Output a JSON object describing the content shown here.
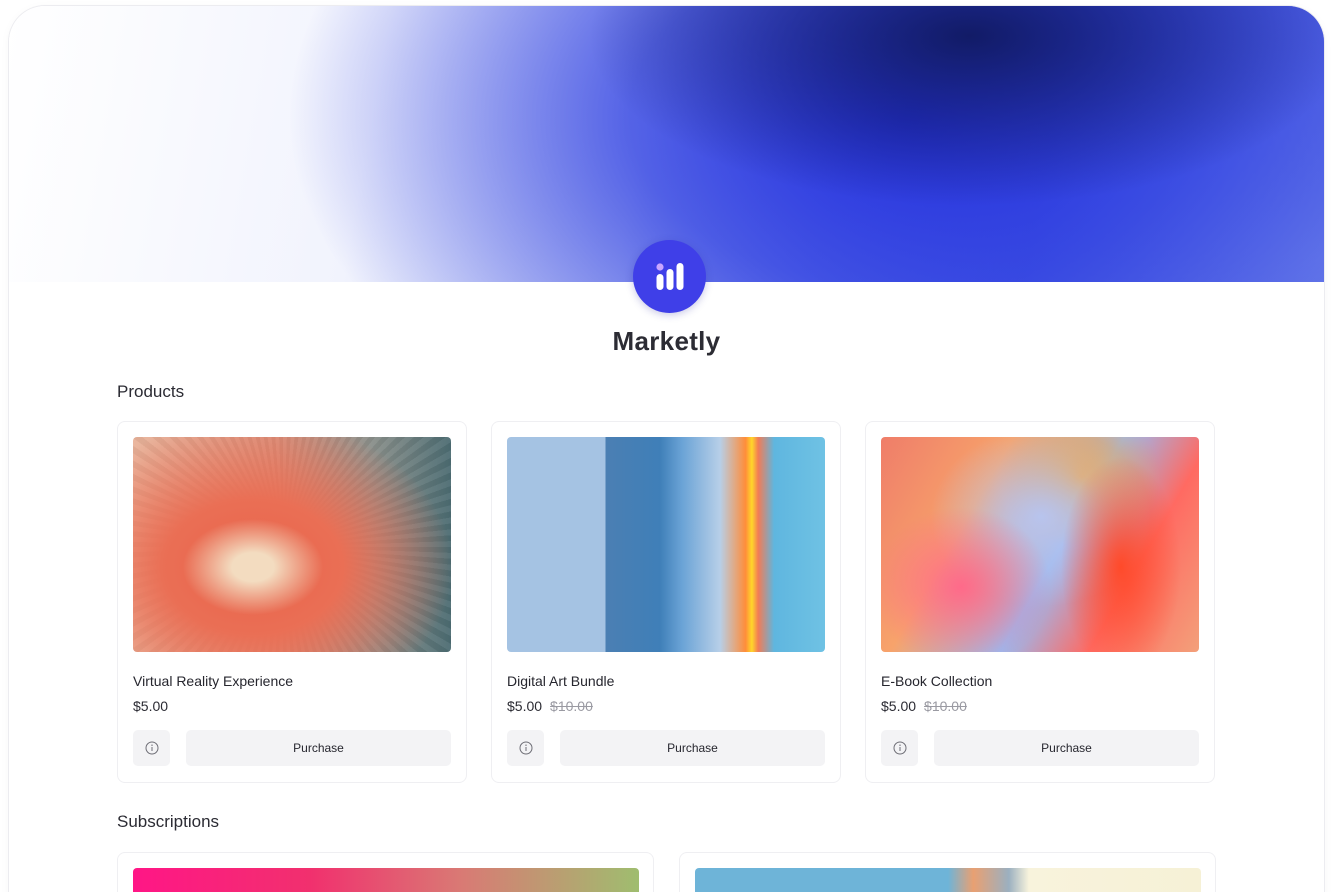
{
  "brand": {
    "name": "Marketly",
    "accent": "#3f3fe8"
  },
  "sections": {
    "products_title": "Products",
    "subscriptions_title": "Subscriptions"
  },
  "products": [
    {
      "name": "Virtual Reality Experience",
      "price": "$5.00",
      "old_price": "",
      "info_icon": "info-icon",
      "action": "Purchase"
    },
    {
      "name": "Digital Art Bundle",
      "price": "$5.00",
      "old_price": "$10.00",
      "info_icon": "info-icon",
      "action": "Purchase"
    },
    {
      "name": "E-Book Collection",
      "price": "$5.00",
      "old_price": "$10.00",
      "info_icon": "info-icon",
      "action": "Purchase"
    }
  ],
  "colors": {
    "hero_deep_blue": "#2430de",
    "button_bg": "#f3f3f5",
    "text": "#2b2b33",
    "muted": "#9a9aa2"
  }
}
